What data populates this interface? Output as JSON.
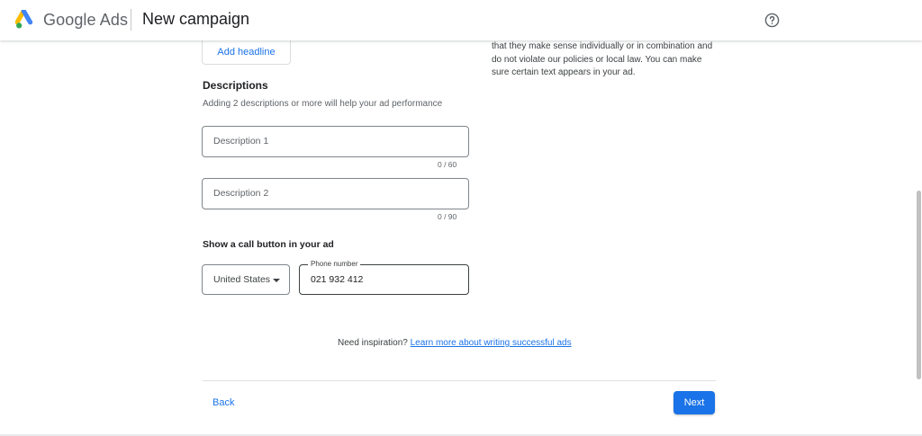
{
  "header": {
    "brand": "Google Ads",
    "title": "New campaign",
    "help_icon": "help-circle-icon",
    "logo_icon": "google-ads-logo"
  },
  "headlines": {
    "add_label": "Add headline"
  },
  "help_panel": {
    "text": "that they make sense individually or in combination and do not violate our policies or local law. You can make sure certain text appears in your ad."
  },
  "descriptions": {
    "title": "Descriptions",
    "subtitle": "Adding 2 descriptions or more will help your ad performance",
    "fields": [
      {
        "placeholder": "Description 1",
        "counter": "0 / 60"
      },
      {
        "placeholder": "Description 2",
        "counter": "0 / 90"
      }
    ]
  },
  "call": {
    "title": "Show a call button in your ad",
    "country": "United States",
    "phone_label": "Phone number",
    "phone_value": "021 932 412"
  },
  "inspiration": {
    "text": "Need inspiration?",
    "link": "Learn more about writing successful ads"
  },
  "footer": {
    "back": "Back",
    "next": "Next"
  },
  "colors": {
    "accent": "#1a73e8",
    "logo_blue": "#4285f4",
    "logo_yellow": "#fbbc04",
    "logo_green": "#34a853"
  }
}
